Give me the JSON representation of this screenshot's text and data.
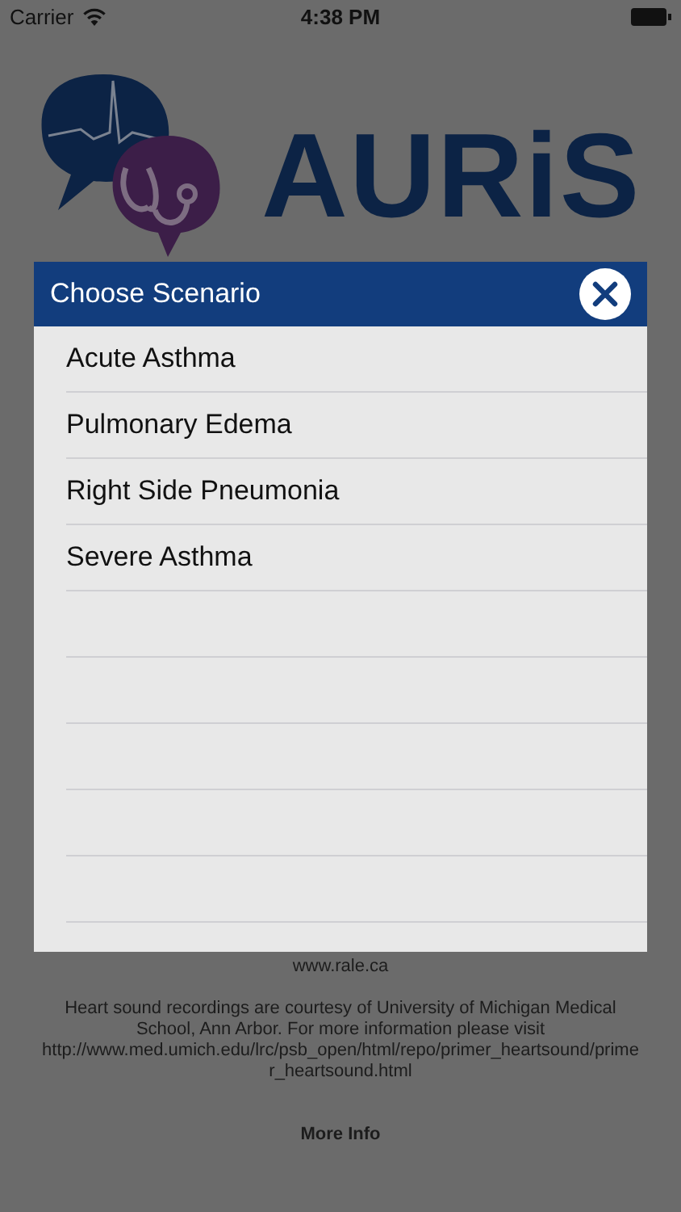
{
  "status_bar": {
    "carrier": "Carrier",
    "time": "4:38 PM"
  },
  "logo": {
    "text": "AURiS"
  },
  "background_text": {
    "link": "www.rale.ca",
    "credit": "Heart sound recordings are courtesy of University of Michigan Medical School, Ann Arbor. For more information please visit http://www.med.umich.edu/lrc/psb_open/html/repo/primer_heartsound/primer_heartsound.html",
    "more_info": "More Info"
  },
  "dialog": {
    "title": "Choose Scenario",
    "items": [
      {
        "label": "Acute Asthma"
      },
      {
        "label": "Pulmonary Edema"
      },
      {
        "label": "Right Side Pneumonia"
      },
      {
        "label": "Severe Asthma"
      }
    ]
  }
}
